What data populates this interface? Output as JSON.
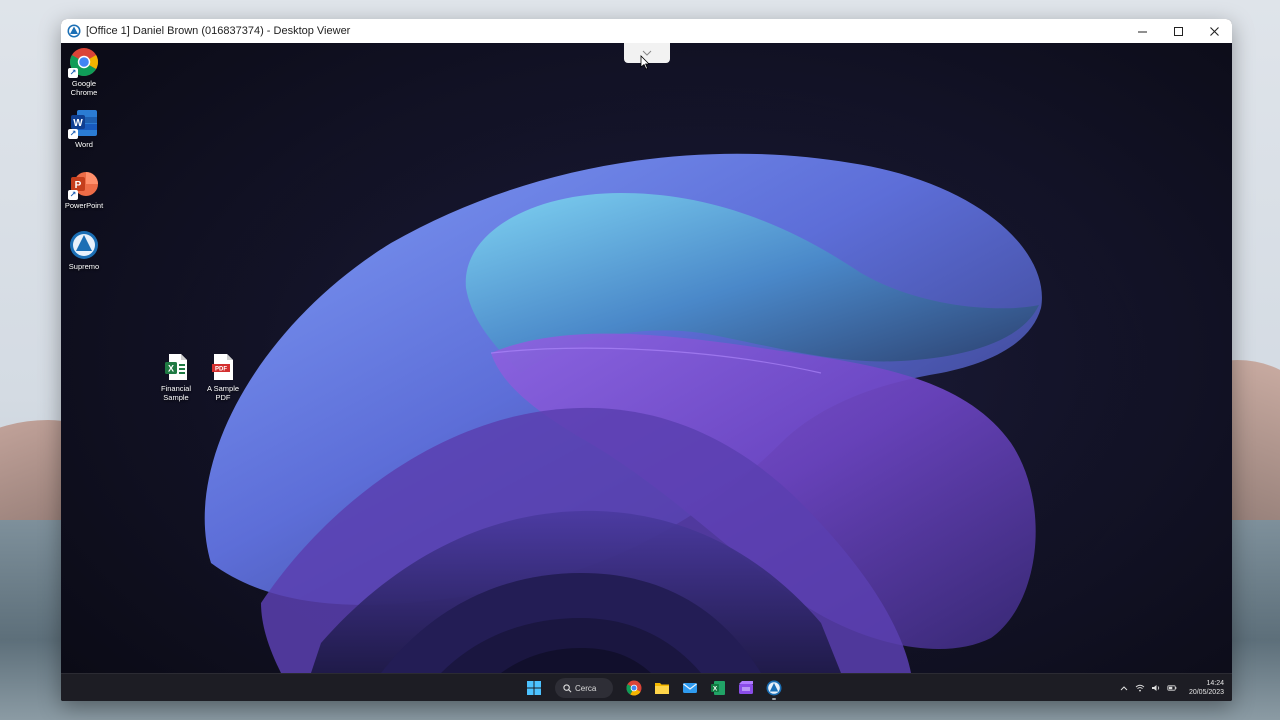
{
  "window": {
    "title": "[Office 1] Daniel Brown (016837374) - Desktop Viewer",
    "controls": {
      "minimize": "minimize-icon",
      "maximize": "maximize-icon",
      "close": "close-icon"
    }
  },
  "desktop": {
    "icons": [
      {
        "label": "Google Chrome",
        "icon": "chrome-icon"
      },
      {
        "label": "Word",
        "icon": "word-icon"
      },
      {
        "label": "PowerPoint",
        "icon": "powerpoint-icon"
      },
      {
        "label": "Supremo",
        "icon": "supremo-icon"
      },
      {
        "label": "Financial Sample",
        "icon": "excel-file-icon"
      },
      {
        "label": "A Sample PDF",
        "icon": "pdf-file-icon"
      }
    ]
  },
  "taskbar": {
    "search_label": "Cerca",
    "apps": [
      "start-icon",
      "chrome-icon",
      "file-explorer-icon",
      "mail-icon",
      "excel-icon",
      "video-editor-icon",
      "supremo-icon"
    ],
    "clock": {
      "time": "14:24",
      "date": "20/05/2023"
    }
  },
  "colors": {
    "accent_excel": "#1f7a43",
    "accent_pdf": "#d32f2f",
    "taskbar_bg": "#1d1d24"
  }
}
